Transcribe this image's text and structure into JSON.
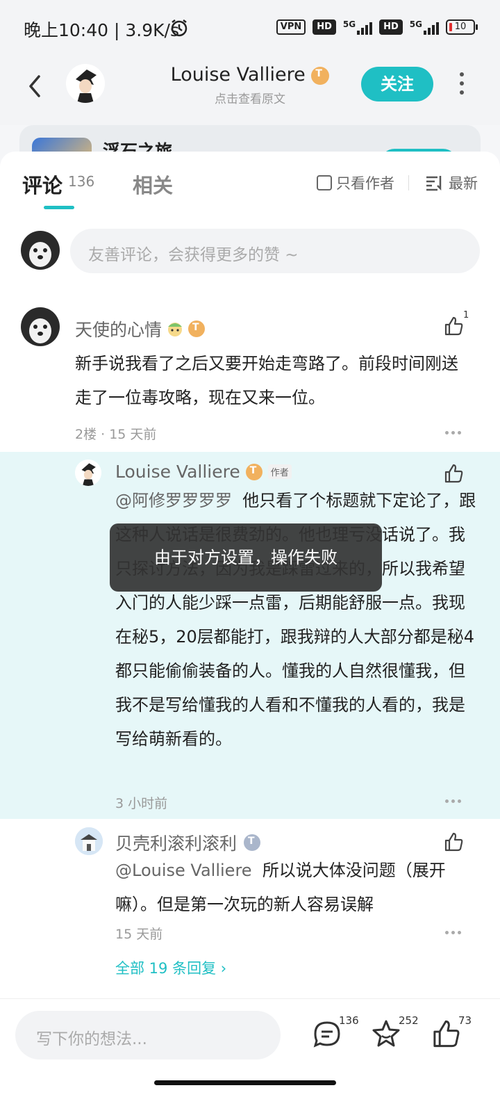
{
  "status_bar": {
    "time_speed": "晚上10:40 | 3.9K/s",
    "vpn": "VPN",
    "hd": "HD",
    "net": "5G",
    "battery": "10"
  },
  "header": {
    "title": "Louise Valliere",
    "subtitle": "点击查看原文",
    "follow_label": "关注"
  },
  "card_peek": {
    "game_name": "浮石之旅"
  },
  "tabs": {
    "comments_label": "评论",
    "comments_count": "136",
    "related_label": "相关",
    "only_author_label": "只看作者",
    "sort_label": "最新"
  },
  "comment_input": {
    "placeholder": "友善评论，会获得更多的赞 ~"
  },
  "comment": {
    "user": "天使的心情",
    "likes": "1",
    "body": "新手说我看了之后又要开始走弯路了。前段时间刚送走了一位毒攻略，现在又来一位。",
    "floor": "2楼 · 15 天前"
  },
  "replies": [
    {
      "user": "Louise Valliere",
      "tag": "作者",
      "mention": "@阿修罗罗罗罗",
      "body": "他只看了个标题就下定论了，跟这种人说话是很费劲的。他也理亏没话说了。我只探讨方法，因为我是踩雷过来的，所以我希望入门的人能少踩一点雷，后期能舒服一点。我现在秘5，20层都能打，跟我辩的人大部分都是秘4都只能偷偷装备的人。懂我的人自然很懂我，但我不是写给懂我的人看和不懂我的人看的，我是写给萌新看的。",
      "time": "3 小时前"
    },
    {
      "user": "贝壳利滚利滚利",
      "mention": "@Louise Valliere",
      "body": "所以说大体没问题（展开嘛）。但是第一次玩的新人容易误解",
      "time": "15 天前"
    }
  ],
  "view_all": "全部 19 条回复 ›",
  "toast": "由于对方设置，操作失败",
  "bottom_bar": {
    "placeholder": "写下你的想法...",
    "comments": "136",
    "favorites": "252",
    "likes": "73"
  }
}
